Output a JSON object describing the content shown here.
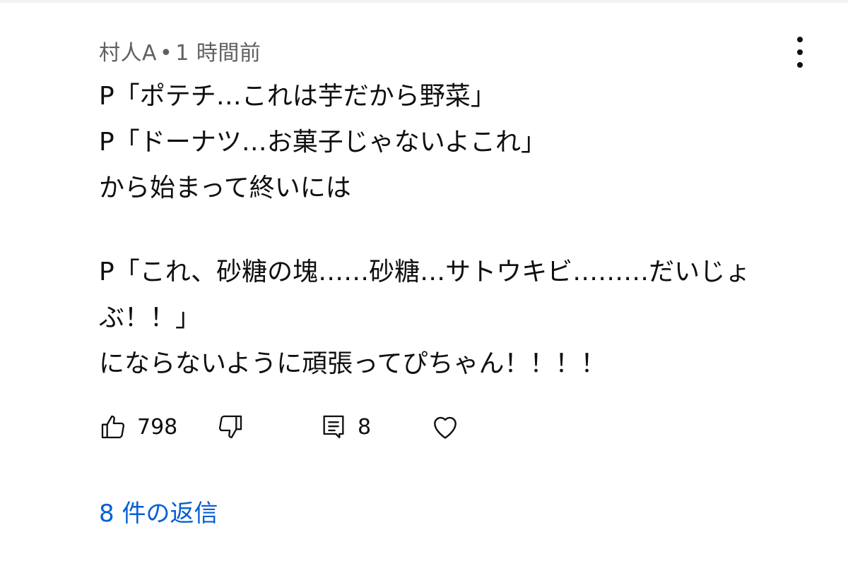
{
  "comment": {
    "author": "村人A",
    "separator": "•",
    "time": "1 時間前",
    "lines": [
      "P「ポテチ…これは芋だから野菜」",
      "P「ドーナツ…お菓子じゃないよこれ」",
      "から始まって終いには",
      "",
      "P「これ、砂糖の塊……砂糖…サトウキビ………だいじょ",
      "ぶ！！」",
      "にならないように頑張ってぴちゃん！！！！"
    ]
  },
  "actions": {
    "like_icon": "thumbs-up-icon",
    "like_count": "798",
    "dislike_icon": "thumbs-down-icon",
    "reply_icon": "comment-icon",
    "reply_count": "8",
    "heart_icon": "heart-icon"
  },
  "replies": {
    "label": "8 件の返信"
  },
  "colors": {
    "text": "#0f0f0f",
    "meta": "#606060",
    "link": "#065fd4"
  }
}
